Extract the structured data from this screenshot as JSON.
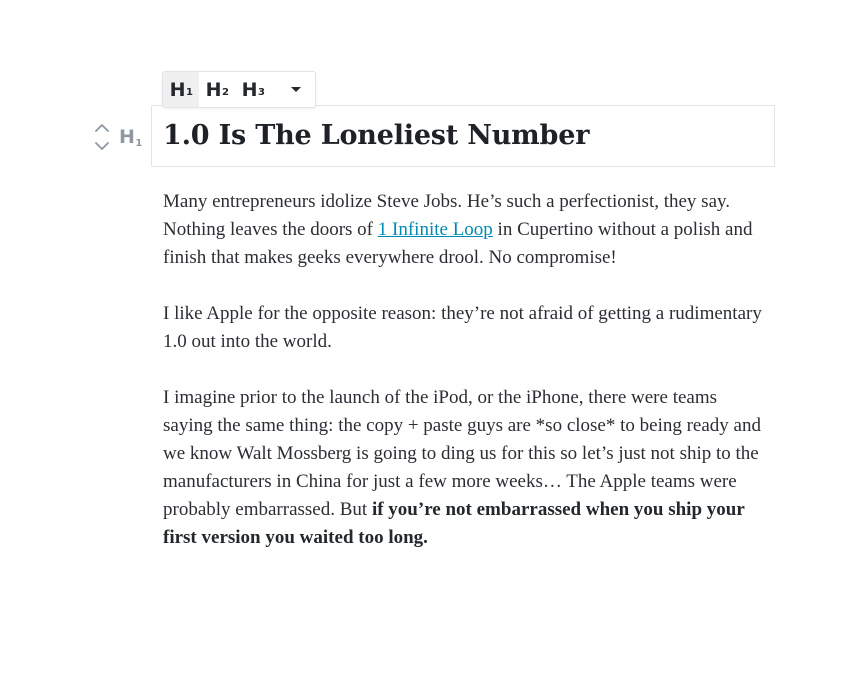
{
  "toolbar": {
    "levels": [
      {
        "letter": "H",
        "number": "1",
        "active": true
      },
      {
        "letter": "H",
        "number": "2",
        "active": false
      },
      {
        "letter": "H",
        "number": "3",
        "active": false
      }
    ],
    "more_icon": "caret-down-icon"
  },
  "block": {
    "type_letter": "H",
    "type_number": "1",
    "mover_up_icon": "chevron-up-icon",
    "mover_down_icon": "chevron-down-icon"
  },
  "heading": {
    "text": "1.0 Is The Loneliest Number"
  },
  "paragraphs": {
    "p1": {
      "before": "Many entrepreneurs idolize Steve Jobs. He’s such a perfectionist, they say. Nothing leaves the doors of ",
      "link": "1 Infinite Loop",
      "after": " in Cupertino without a polish and finish that makes geeks everywhere drool. No compromise!"
    },
    "p2": {
      "text": "I like Apple for the opposite reason: they’re not afraid of getting a rudimentary 1.0 out into the world."
    },
    "p3": {
      "before": "I imagine prior to the launch of the iPod, or the iPhone, there were teams saying the same thing: the copy + paste guys are *so close* to being ready and we know Walt Mossberg is going to ding us for this so let’s just not ship to the manufacturers in China for just a few more weeks… The Apple teams were probably embarrassed. But ",
      "bold": "if you’re not embarrassed when you ship your first version you waited too long."
    }
  },
  "colors": {
    "link": "#0089b3",
    "text": "#2b2e34",
    "heading": "#1e2227",
    "border": "#e2e4e7",
    "muted_icon": "#8f98a1"
  }
}
